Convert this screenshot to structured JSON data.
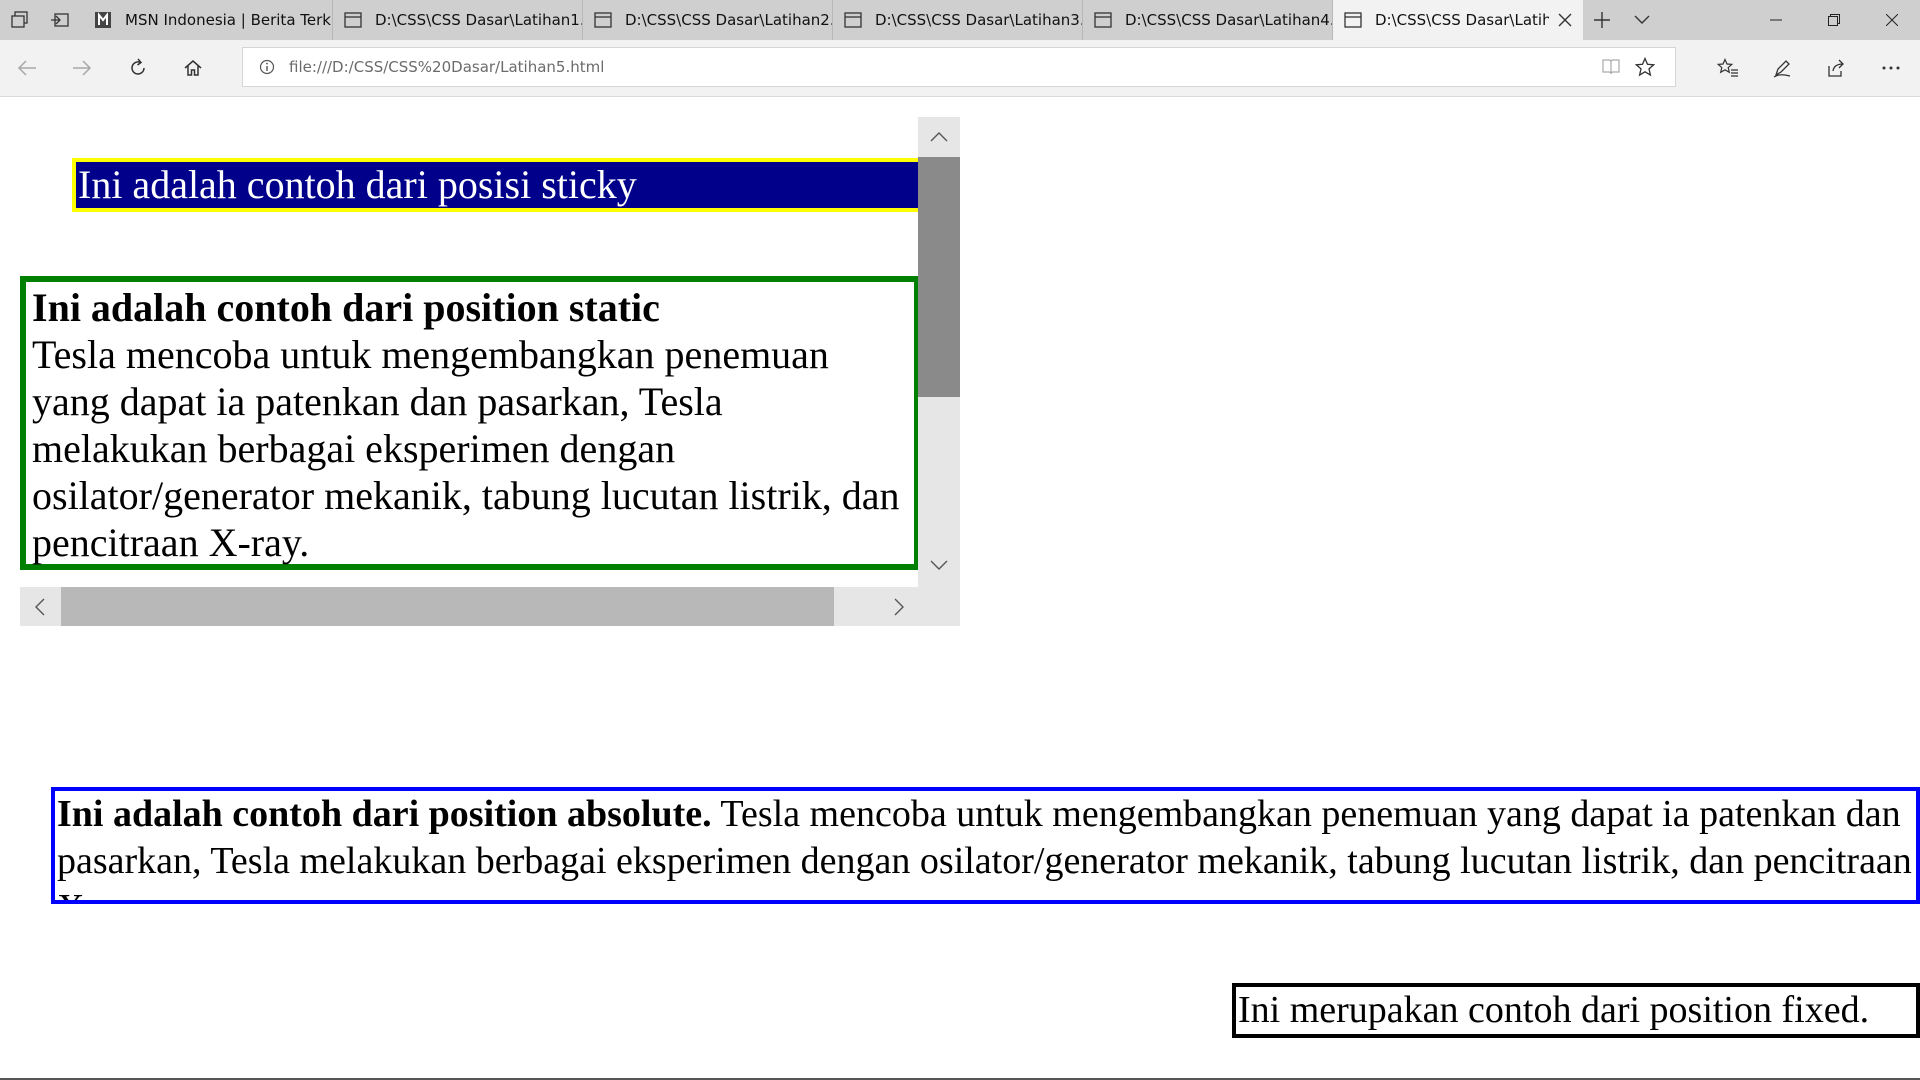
{
  "browser": {
    "tabs": [
      {
        "label": "MSN Indonesia | Berita Terk",
        "icon": "msn-icon"
      },
      {
        "label": "D:\\CSS\\CSS Dasar\\Latihan1.",
        "icon": "page-icon"
      },
      {
        "label": "D:\\CSS\\CSS Dasar\\Latihan2.",
        "icon": "page-icon"
      },
      {
        "label": "D:\\CSS\\CSS Dasar\\Latihan3.",
        "icon": "page-icon"
      },
      {
        "label": "D:\\CSS\\CSS Dasar\\Latihan4.",
        "icon": "page-icon"
      },
      {
        "label": "D:\\CSS\\CSS Dasar\\Latih",
        "icon": "page-icon",
        "active": true
      }
    ],
    "address": {
      "url": "file:///D:/CSS/CSS%20Dasar/Latihan5.html"
    }
  },
  "page": {
    "sticky_text": "Ini adalah contoh dari posisi sticky",
    "static": {
      "heading": "Ini adalah contoh dari position static",
      "body": "Tesla mencoba untuk mengembangkan penemuan yang dapat ia patenkan dan pasarkan, Tesla melakukan berbagai eksperimen dengan osilator/generator mekanik, tabung lucutan listrik, dan pencitraan X-ray."
    },
    "absolute": {
      "heading": "Ini adalah contoh dari position absolute.",
      "body": " Tesla mencoba untuk mengembangkan penemuan yang dapat ia patenkan dan pasarkan, Tesla melakukan berbagai eksperimen dengan osilator/generator mekanik, tabung lucutan listrik, dan pencitraan X-ray."
    },
    "fixed_text": "Ini merupakan contoh dari position fixed."
  },
  "colors": {
    "sticky_bg": "#00008b",
    "sticky_border": "#ffff00",
    "static_border": "#008000",
    "absolute_border": "#0000ff",
    "fixed_border": "#000000"
  }
}
